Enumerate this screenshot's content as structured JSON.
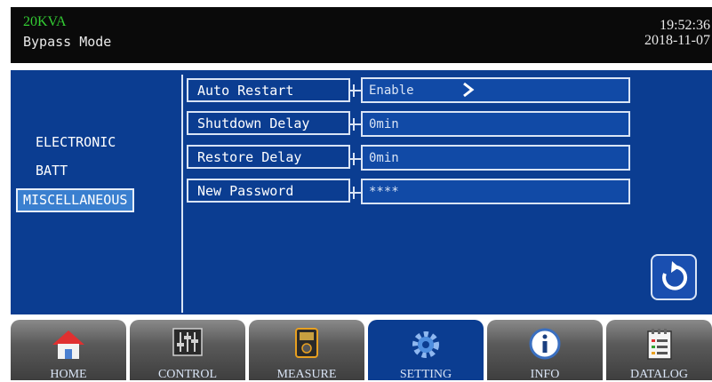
{
  "header": {
    "model": "20KVA",
    "mode": "Bypass Mode",
    "time": "19:52:36",
    "date": "2018-11-07"
  },
  "categories": [
    {
      "label": "ELECTRONIC",
      "selected": false
    },
    {
      "label": "BATT",
      "selected": false
    },
    {
      "label": "MISCELLANEOUS",
      "selected": true
    }
  ],
  "settings": [
    {
      "label": "Auto Restart",
      "value": "Enable"
    },
    {
      "label": "Shutdown Delay",
      "value": "0min"
    },
    {
      "label": "Restore Delay",
      "value": "0min"
    },
    {
      "label": "New Password",
      "value": "****"
    }
  ],
  "tabs": [
    "HOME",
    "CONTROL",
    "MEASURE",
    "SETTING",
    "INFO",
    "DATALOG"
  ],
  "active_tab": "SETTING",
  "icons": {
    "next": "chevron-right-icon",
    "refresh": "refresh-icon"
  },
  "colors": {
    "panel": "#0b3d91",
    "model_text": "#33cc33",
    "selected_category": "#3a7fcf"
  }
}
